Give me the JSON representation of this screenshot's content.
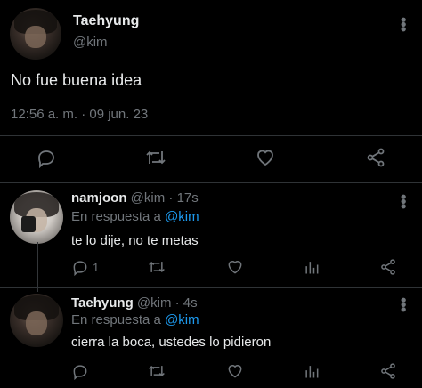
{
  "main_tweet": {
    "display_name": "Taehyung",
    "handle": "@kim",
    "text": "No fue buena idea",
    "timestamp": "12:56 a. m. · 09 jun. 23",
    "more_icon": "more-vertical-icon"
  },
  "replies": [
    {
      "display_name": "namjoon",
      "handle": "@kim",
      "time": "· 17s",
      "replying_prefix": "En respuesta a",
      "replying_to": "@kim",
      "text": "te lo dije, no te metas",
      "reply_count": "1"
    },
    {
      "display_name": "Taehyung",
      "handle": "@kim",
      "time": "· 4s",
      "replying_prefix": "En respuesta a",
      "replying_to": "@kim",
      "text": "cierra la boca, ustedes lo pidieron",
      "reply_count": ""
    }
  ],
  "colors": {
    "background": "#000000",
    "text": "#e7e9ea",
    "muted": "#71767b",
    "accent": "#1d9bf0",
    "divider": "#2f3336"
  }
}
